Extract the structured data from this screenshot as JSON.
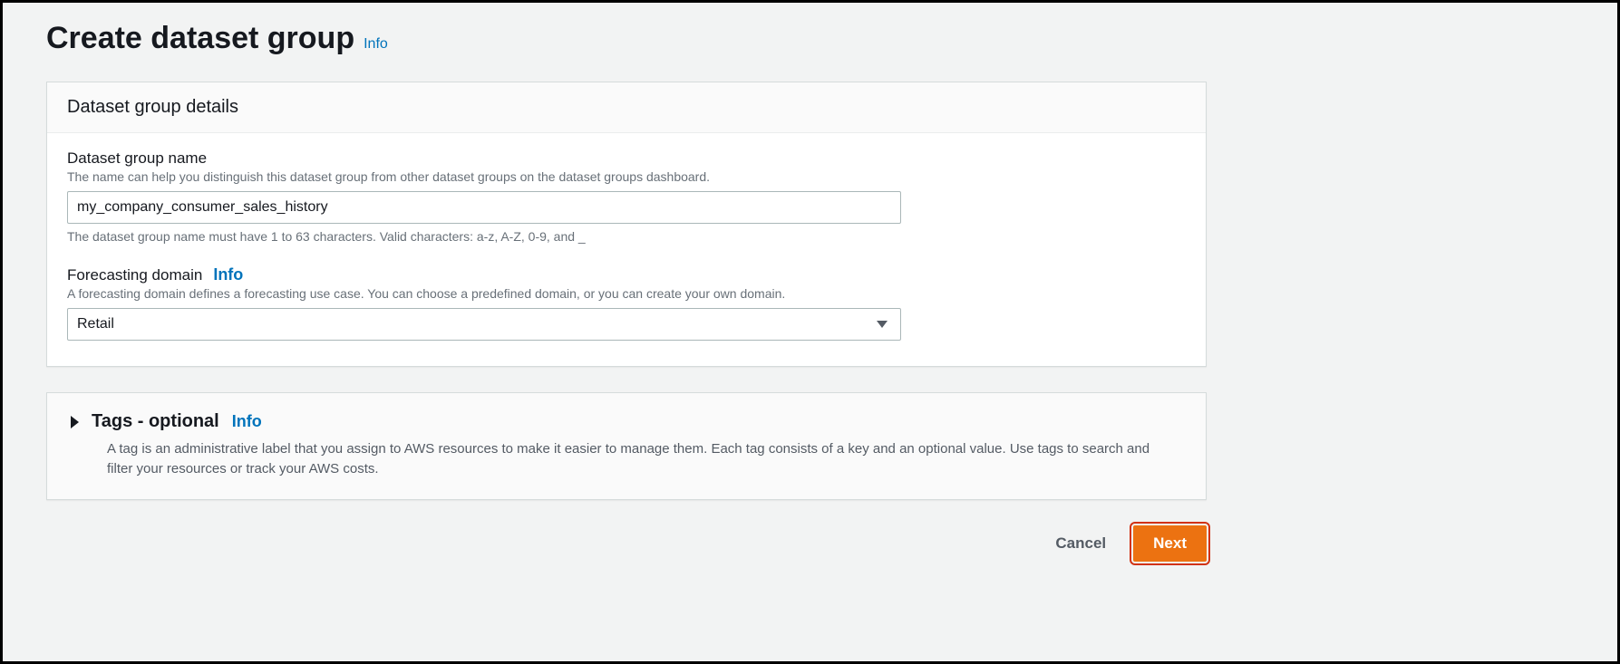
{
  "header": {
    "title": "Create dataset group",
    "info": "Info"
  },
  "details_panel": {
    "title": "Dataset group details",
    "name_field": {
      "label": "Dataset group name",
      "description": "The name can help you distinguish this dataset group from other dataset groups on the dataset groups dashboard.",
      "value": "my_company_consumer_sales_history",
      "hint": "The dataset group name must have 1 to 63 characters. Valid characters: a-z, A-Z, 0-9, and _"
    },
    "domain_field": {
      "label": "Forecasting domain",
      "info": "Info",
      "description": "A forecasting domain defines a forecasting use case. You can choose a predefined domain, or you can create your own domain.",
      "selected": "Retail"
    }
  },
  "tags_panel": {
    "title": "Tags - optional",
    "info": "Info",
    "description": "A tag is an administrative label that you assign to AWS resources to make it easier to manage them. Each tag consists of a key and an optional value. Use tags to search and filter your resources or track your AWS costs."
  },
  "footer": {
    "cancel": "Cancel",
    "next": "Next"
  }
}
